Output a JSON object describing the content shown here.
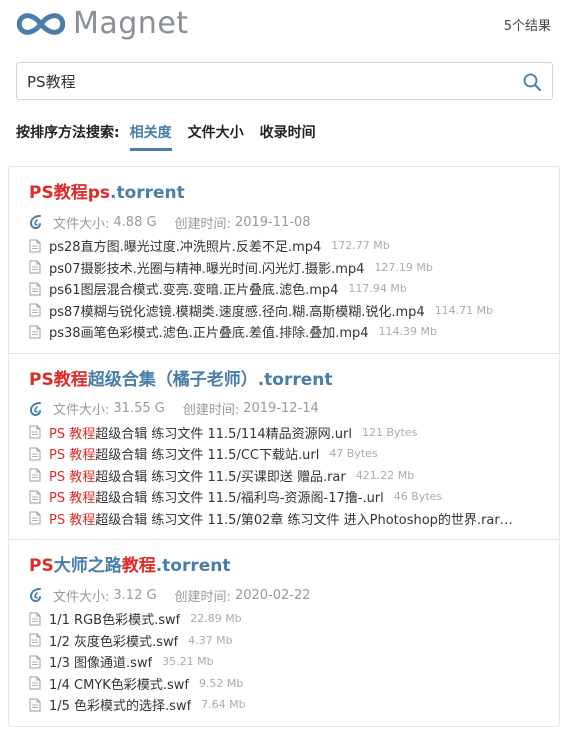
{
  "header": {
    "logo_text": "Magnet",
    "result_count": "5个结果"
  },
  "search": {
    "value": "PS教程",
    "placeholder": ""
  },
  "sort": {
    "label": "按排序方法搜索:",
    "tabs": [
      "相关度",
      "文件大小",
      "收录时间"
    ],
    "active": "相关度"
  },
  "colors": {
    "accent": "#4a7ea8",
    "keyword": "#e02b2b",
    "muted": "#999999"
  },
  "results": [
    {
      "title_parts": [
        {
          "text": "PS教程ps",
          "kw": true
        },
        {
          "text": ".torrent",
          "kw": false
        }
      ],
      "size_label": "文件大小:",
      "size": "4.88 G",
      "date_label": "创建时间:",
      "date": "2019-11-08",
      "files": [
        {
          "name_parts": [
            {
              "text": "ps28直方图.曝光过度.冲洗照片.反差不足.mp4",
              "kw": false
            }
          ],
          "size": "172.77 Mb"
        },
        {
          "name_parts": [
            {
              "text": "ps07摄影技术.光圈与精神.曝光时间.闪光灯.摄影.mp4",
              "kw": false
            }
          ],
          "size": "127.19 Mb"
        },
        {
          "name_parts": [
            {
              "text": "ps61图层混合模式.变亮.变暗.正片叠底.滤色.mp4",
              "kw": false
            }
          ],
          "size": "117.94 Mb"
        },
        {
          "name_parts": [
            {
              "text": "ps87模糊与锐化滤镜.模糊类.速度感.径向.糊.高斯模糊.锐化.mp4",
              "kw": false
            }
          ],
          "size": "114.71 Mb"
        },
        {
          "name_parts": [
            {
              "text": "ps38画笔色彩模式.滤色.正片叠底.差值.排除.叠加.mp4",
              "kw": false
            }
          ],
          "size": "114.39 Mb"
        }
      ]
    },
    {
      "title_parts": [
        {
          "text": "PS教程",
          "kw": true
        },
        {
          "text": "超级合集（橘子老师）.torrent",
          "kw": false
        }
      ],
      "size_label": "文件大小:",
      "size": "31.55 G",
      "date_label": "创建时间:",
      "date": "2019-12-14",
      "files": [
        {
          "name_parts": [
            {
              "text": "PS 教程",
              "kw": true
            },
            {
              "text": "超级合辑 练习文件 11.5/114精品资源网.url",
              "kw": false
            }
          ],
          "size": "121 Bytes"
        },
        {
          "name_parts": [
            {
              "text": "PS 教程",
              "kw": true
            },
            {
              "text": "超级合辑 练习文件 11.5/CC下载站.url",
              "kw": false
            }
          ],
          "size": "47 Bytes"
        },
        {
          "name_parts": [
            {
              "text": "PS 教程",
              "kw": true
            },
            {
              "text": "超级合辑 练习文件 11.5/买课即送 赠品.rar",
              "kw": false
            }
          ],
          "size": "421.22 Mb"
        },
        {
          "name_parts": [
            {
              "text": "PS 教程",
              "kw": true
            },
            {
              "text": "超级合辑 练习文件 11.5/福利鸟-资源阁-17撸-.url",
              "kw": false
            }
          ],
          "size": "46 Bytes"
        },
        {
          "name_parts": [
            {
              "text": "PS 教程",
              "kw": true
            },
            {
              "text": "超级合辑 练习文件 11.5/第02章 练习文件 进入Photoshop的世界.rar…",
              "kw": false
            }
          ],
          "size": ""
        }
      ]
    },
    {
      "title_parts": [
        {
          "text": "PS",
          "kw": true
        },
        {
          "text": "大师之路",
          "kw": false
        },
        {
          "text": "教程",
          "kw": true
        },
        {
          "text": ".torrent",
          "kw": false
        }
      ],
      "size_label": "文件大小:",
      "size": "3.12 G",
      "date_label": "创建时间:",
      "date": "2020-02-22",
      "files": [
        {
          "name_parts": [
            {
              "text": "1/1 RGB色彩模式.swf",
              "kw": false
            }
          ],
          "size": "22.89 Mb"
        },
        {
          "name_parts": [
            {
              "text": "1/2 灰度色彩模式.swf",
              "kw": false
            }
          ],
          "size": "4.37 Mb"
        },
        {
          "name_parts": [
            {
              "text": "1/3 图像通道.swf",
              "kw": false
            }
          ],
          "size": "35.21 Mb"
        },
        {
          "name_parts": [
            {
              "text": "1/4 CMYK色彩模式.swf",
              "kw": false
            }
          ],
          "size": "9.52 Mb"
        },
        {
          "name_parts": [
            {
              "text": "1/5 色彩模式的选择.swf",
              "kw": false
            }
          ],
          "size": "7.64 Mb"
        }
      ]
    }
  ]
}
